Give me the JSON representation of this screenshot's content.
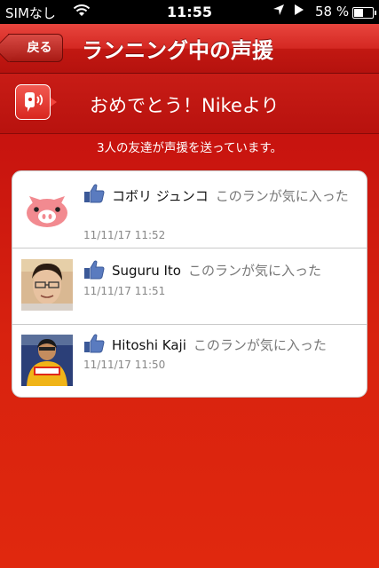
{
  "status_bar": {
    "carrier": "SIMなし",
    "time": "11:55",
    "battery_percent": "58 %",
    "battery_level": 0.58
  },
  "nav": {
    "back_label": "戻る",
    "title": "ランニング中の声援"
  },
  "banner": {
    "text": "おめでとう！Nikeより"
  },
  "friend_count_text": "3人の友達が声援を送っています。",
  "cheers": [
    {
      "name": "コボリ ジュンコ",
      "action": "このランが気に入った",
      "timestamp": "11/11/17  11:52",
      "avatar": "pig-avatar"
    },
    {
      "name": "Suguru Ito",
      "action": "このランが気に入った",
      "timestamp": "11/11/17  11:51",
      "avatar": "profile-photo"
    },
    {
      "name": "Hitoshi Kaji",
      "action": "このランが気に入った",
      "timestamp": "11/11/17  11:50",
      "avatar": "profile-photo"
    }
  ],
  "icons": {
    "like": "thumbs-up-icon",
    "cheer": "cheer-speaker-icon"
  },
  "colors": {
    "accent_red": "#c8140f",
    "like_blue": "#3b5998"
  }
}
